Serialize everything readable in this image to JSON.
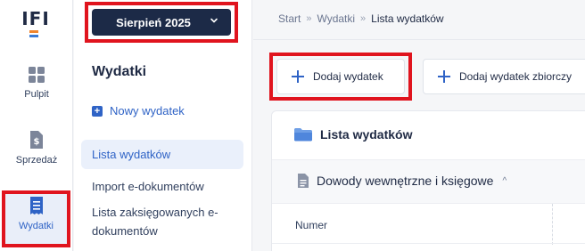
{
  "rail": {
    "logo": "IFI",
    "items": [
      {
        "label": "Pulpit",
        "icon": "grid-icon"
      },
      {
        "label": "Sprzedaż",
        "icon": "invoice-dollar-icon"
      },
      {
        "label": "Wydatki",
        "icon": "receipt-icon",
        "active": true
      }
    ]
  },
  "sidebar": {
    "month": "Sierpień 2025",
    "title": "Wydatki",
    "new_expense": "Nowy wydatek",
    "nav": [
      {
        "label": "Lista wydatków",
        "active": true
      },
      {
        "label": "Import e-dokumentów"
      },
      {
        "label": "Lista zaksięgowanych e-dokumentów"
      }
    ]
  },
  "breadcrumb": [
    "Start",
    "Wydatki",
    "Lista wydatków"
  ],
  "toolbar": {
    "add_label": "Dodaj wydatek",
    "bulk_label": "Dodaj wydatek zbiorczy"
  },
  "panel": {
    "title": "Lista wydatków",
    "section": "Dowody wewnętrzne i księgowe",
    "columns": [
      "Numer"
    ]
  },
  "colors": {
    "accent": "#2f63c6",
    "navy": "#1c2a47",
    "highlight": "#e0141e"
  }
}
